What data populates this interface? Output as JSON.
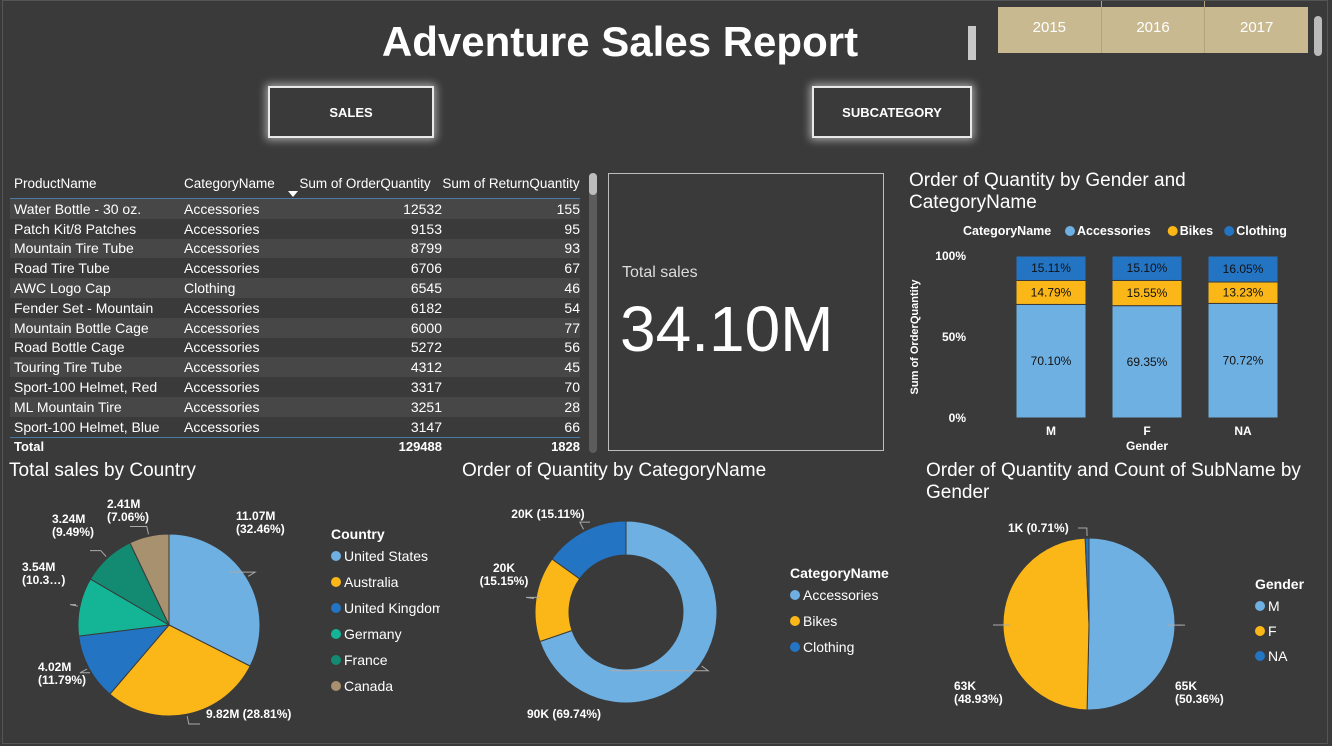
{
  "header": {
    "title": "Adventure Sales Report",
    "years": [
      "2015",
      "2016",
      "2017"
    ]
  },
  "nav": {
    "sales_label": "SALES",
    "subcategory_label": "SUBCATEGORY"
  },
  "table": {
    "columns": [
      "ProductName",
      "CategoryName",
      "Sum of OrderQuantity",
      "Sum of ReturnQuantity"
    ],
    "rows": [
      [
        "Water Bottle - 30 oz.",
        "Accessories",
        "12532",
        "155"
      ],
      [
        "Patch Kit/8 Patches",
        "Accessories",
        "9153",
        "95"
      ],
      [
        "Mountain Tire Tube",
        "Accessories",
        "8799",
        "93"
      ],
      [
        "Road Tire Tube",
        "Accessories",
        "6706",
        "67"
      ],
      [
        "AWC Logo Cap",
        "Clothing",
        "6545",
        "46"
      ],
      [
        "Fender Set - Mountain",
        "Accessories",
        "6182",
        "54"
      ],
      [
        "Mountain Bottle Cage",
        "Accessories",
        "6000",
        "77"
      ],
      [
        "Road Bottle Cage",
        "Accessories",
        "5272",
        "56"
      ],
      [
        "Touring Tire Tube",
        "Accessories",
        "4312",
        "45"
      ],
      [
        "Sport-100 Helmet, Red",
        "Accessories",
        "3317",
        "70"
      ],
      [
        "ML Mountain Tire",
        "Accessories",
        "3251",
        "28"
      ],
      [
        "Sport-100 Helmet, Blue",
        "Accessories",
        "3147",
        "66"
      ]
    ],
    "total": [
      "Total",
      "",
      "129488",
      "1828"
    ]
  },
  "card": {
    "label": "Total sales",
    "value": "34.10M"
  },
  "colors": {
    "light_blue": "#6fb0e2",
    "yellow": "#fbb718",
    "dark_blue": "#2474c4",
    "green": "#13b596",
    "dark_green": "#138a72",
    "tan": "#a8916f"
  },
  "chart_data": [
    {
      "type": "bar",
      "stacked": "100%",
      "title": "Order of Quantity by Gender and CategoryName",
      "legend_title": "CategoryName",
      "xlabel": "Gender",
      "ylabel": "Sum of OrderQuantity",
      "ylim": [
        0,
        100
      ],
      "yticks": [
        "0%",
        "50%",
        "100%"
      ],
      "categories": [
        "M",
        "F",
        "NA"
      ],
      "series": [
        {
          "name": "Accessories",
          "values": [
            70.1,
            69.35,
            70.72
          ],
          "labels": [
            "70.10%",
            "69.35%",
            "70.72%"
          ],
          "color": "#6fb0e2"
        },
        {
          "name": "Bikes",
          "values": [
            14.79,
            15.55,
            13.23
          ],
          "labels": [
            "14.79%",
            "15.55%",
            "13.23%"
          ],
          "color": "#fbb718"
        },
        {
          "name": "Clothing",
          "values": [
            15.11,
            15.1,
            16.05
          ],
          "labels": [
            "15.11%",
            "15.10%",
            "16.05%"
          ],
          "color": "#2474c4"
        }
      ]
    },
    {
      "type": "pie",
      "title": "Total sales by Country",
      "legend_title": "Country",
      "slices": [
        {
          "name": "United States",
          "value": 11.07,
          "label": "11.07M\n(32.46%)",
          "color": "#6fb0e2"
        },
        {
          "name": "Australia",
          "value": 9.82,
          "label": "9.82M (28.81%)",
          "color": "#fbb718"
        },
        {
          "name": "United Kingdom",
          "value": 4.02,
          "label": "4.02M\n(11.79%)",
          "color": "#2474c4"
        },
        {
          "name": "Germany",
          "value": 3.54,
          "label": "3.54M\n(10.3…)",
          "color": "#13b596"
        },
        {
          "name": "France",
          "value": 3.24,
          "label": "3.24M\n(9.49%)",
          "color": "#138a72"
        },
        {
          "name": "Canada",
          "value": 2.41,
          "label": "2.41M\n(7.06%)",
          "color": "#a8916f"
        }
      ]
    },
    {
      "type": "pie",
      "donut": true,
      "title": "Order of Quantity by CategoryName",
      "legend_title": "CategoryName",
      "slices": [
        {
          "name": "Accessories",
          "value": 69.74,
          "label": "90K (69.74%)",
          "color": "#6fb0e2"
        },
        {
          "name": "Bikes",
          "value": 15.15,
          "label": "20K\n(15.15%)",
          "color": "#fbb718"
        },
        {
          "name": "Clothing",
          "value": 15.11,
          "label": "20K (15.11%)",
          "color": "#2474c4"
        }
      ]
    },
    {
      "type": "pie",
      "title": "Order of Quantity and Count of SubName by Gender",
      "legend_title": "Gender",
      "slices": [
        {
          "name": "M",
          "value": 50.36,
          "label": "65K\n(50.36%)",
          "color": "#6fb0e2"
        },
        {
          "name": "F",
          "value": 48.93,
          "label": "63K\n(48.93%)",
          "color": "#fbb718"
        },
        {
          "name": "NA",
          "value": 0.71,
          "label": "1K (0.71%)",
          "color": "#2474c4"
        }
      ]
    }
  ]
}
